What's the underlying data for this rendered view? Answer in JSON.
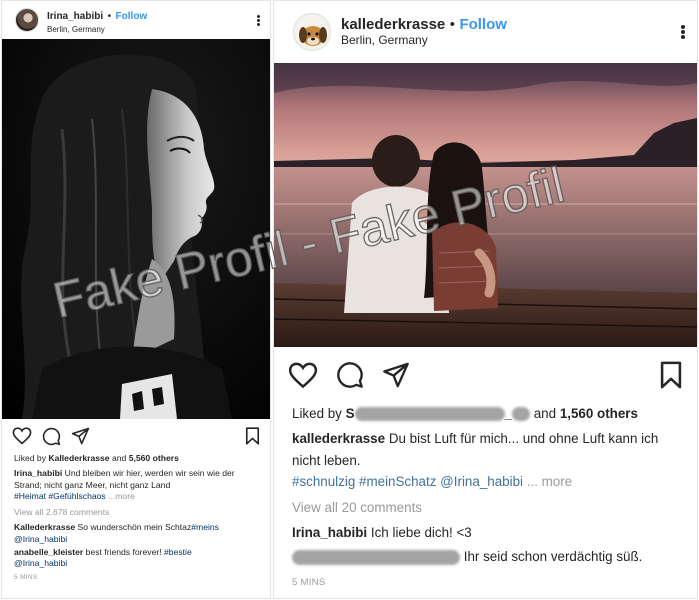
{
  "left_post": {
    "username": "Irina_habibi",
    "separator": "•",
    "follow_label": "Follow",
    "location": "Berlin, Germany",
    "liked_by": {
      "prefix": "Liked by",
      "user": "Kallederkrasse",
      "middle": "and",
      "count": "5,560 others"
    },
    "caption": {
      "user": "Irina_habibi",
      "text": "Und bleiben wir hier, werden wir sein wie der Strand; nicht ganz Meer, nicht ganz Land",
      "hashtags": [
        "#Heimat",
        "#Gefühlschaos"
      ],
      "more": "...more"
    },
    "view_all_comments": "View all 2.678 comments",
    "comments": [
      {
        "user": "Kallederkrasse",
        "text": "So wunderschön mein Schtaz",
        "tag": "#meins",
        "mention": "@Irina_habibi"
      },
      {
        "user": "anabelle_kleister",
        "text": "best friends forever!",
        "tag": "#bestie",
        "mention": "@Irina_habibi"
      }
    ],
    "time": "5 MINS"
  },
  "right_post": {
    "username": "kallederkrasse",
    "separator": "•",
    "follow_label": "Follow",
    "location": "Berlin, Germany",
    "liked_by": {
      "prefix": "Liked by",
      "user_partial": "S",
      "user_partial_end": "_",
      "middle": "and",
      "count": "1,560 others"
    },
    "caption": {
      "user": "kallederkrasse",
      "text": "Du bist Luft für mich... und ohne Luft kann ich nicht leben.",
      "hashtags": [
        "#schnulzig",
        "#meinSchatz"
      ],
      "mention": "@Irina_habibi",
      "more": "... more"
    },
    "view_all_comments": "View all 20 comments",
    "comments": [
      {
        "user": "Irina_habibi",
        "text": "Ich liebe dich! <3"
      },
      {
        "user": "",
        "text": "Ihr seid schon verdächtig süß."
      }
    ],
    "time": "5 MINS"
  },
  "watermark": "Fake Profil - Fake Profil",
  "colors": {
    "link_blue": "#3897f0",
    "hashtag_left": "#003569",
    "hashtag_right": "#3f729b",
    "muted": "#999999",
    "text": "#262626"
  },
  "icons": [
    "heart-icon",
    "comment-icon",
    "share-icon",
    "bookmark-icon",
    "more-options-icon"
  ]
}
